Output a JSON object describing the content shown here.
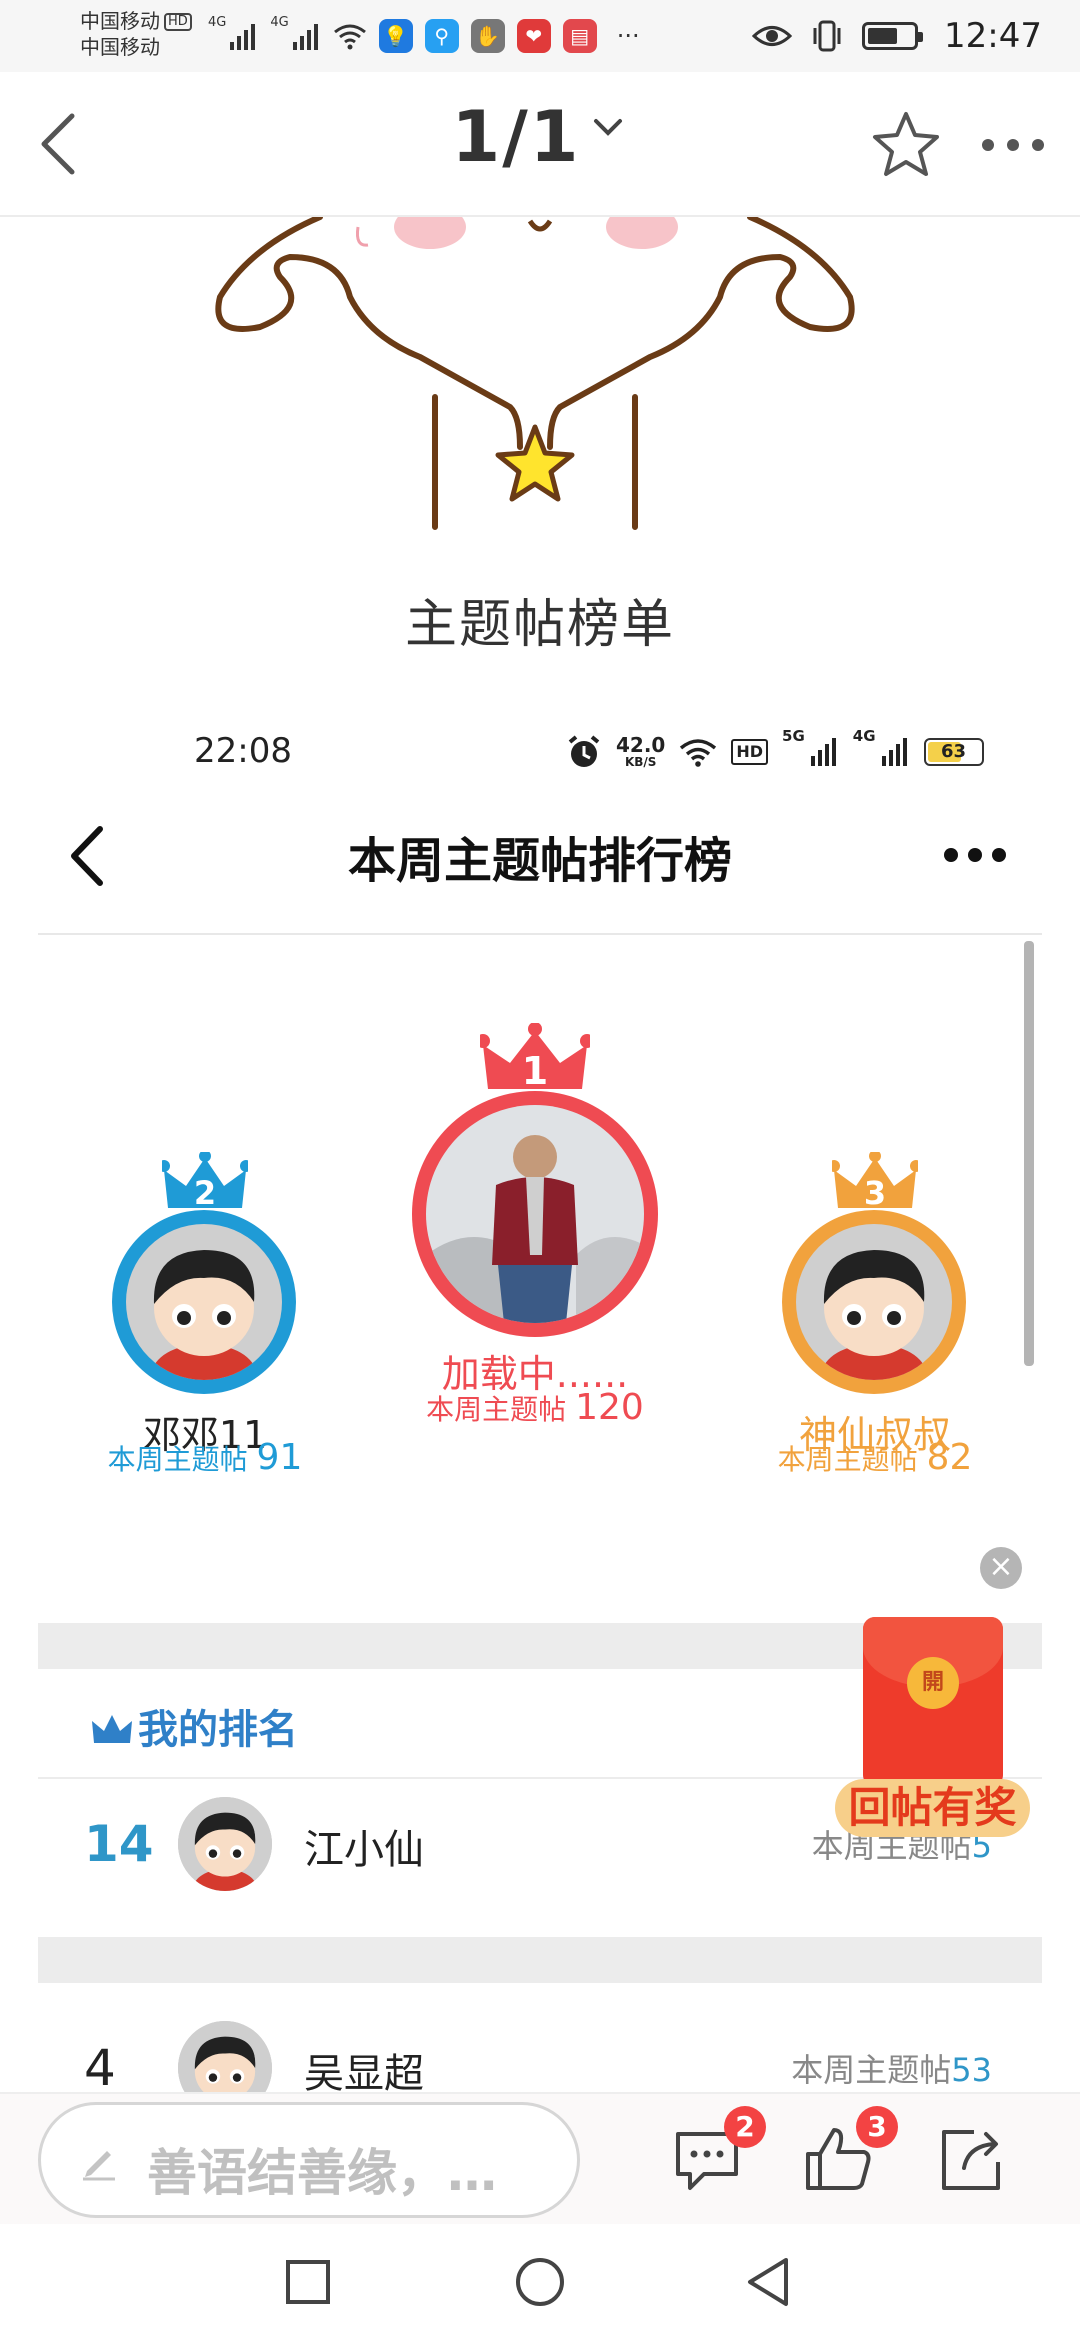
{
  "status_bar": {
    "carrier_1": "中国移动",
    "carrier_1_tag": "HD",
    "carrier_2": "中国移动",
    "network_1": "4G",
    "network_2": "4G",
    "time": "12:47",
    "battery_level": 0.65,
    "more_glyph": "···",
    "app_icons": [
      "lightbulb-app-icon",
      "search-app-icon",
      "hand-app-icon",
      "heart-app-icon",
      "book-app-icon"
    ]
  },
  "viewer": {
    "page_indicator": "1/1",
    "icons": [
      "back-arrow-icon",
      "chevron-down-icon",
      "star-icon",
      "more-icon"
    ]
  },
  "screenshot": {
    "caption": "主题帖榜单",
    "inner_status": {
      "time": "22:08",
      "speed_value": "42.0",
      "speed_unit": "KB/S",
      "hd_label": "HD",
      "net_1": "5G",
      "net_2": "4G",
      "battery_value": "63",
      "battery_level": 0.63
    },
    "page_title": "本周主题帖排行榜",
    "podium": [
      {
        "rank": "2",
        "name": "邓邓11",
        "count_label": "本周主题帖",
        "count": "91",
        "color": "#1f9bd6"
      },
      {
        "rank": "1",
        "name": "加载中......",
        "count_label": "本周主题帖",
        "count": "120",
        "color": "#ef4b52"
      },
      {
        "rank": "3",
        "name": "神仙叔叔",
        "count_label": "本周主题帖",
        "count": "82",
        "color": "#f1a23d"
      }
    ],
    "my_rank_heading": "我的排名",
    "my_rank": {
      "rank": "14",
      "name": "江小仙",
      "count_label": "本周主题帖",
      "count": "5"
    },
    "list": [
      {
        "rank": "4",
        "name": "吴显超",
        "count_label": "本周主题帖",
        "count": "53"
      }
    ],
    "ad": {
      "coin_text": "開",
      "label": "回帖有奖",
      "close": "×"
    }
  },
  "bottom_bar": {
    "comment_placeholder": "善语结善缘，…",
    "comment_badge": "2",
    "like_badge": "3"
  },
  "colors": {
    "accent_blue": "#2f80c8",
    "gold": "#f1a23d",
    "red": "#ef4b52",
    "badge_red": "#f34343"
  }
}
